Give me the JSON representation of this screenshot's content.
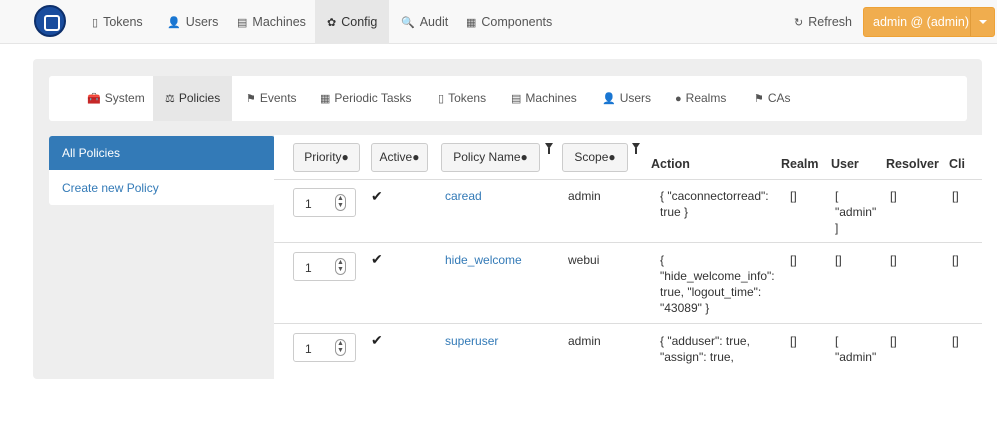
{
  "topnav": {
    "items": [
      {
        "label": "Tokens",
        "icon": "▯"
      },
      {
        "label": "Users",
        "icon": "👤"
      },
      {
        "label": "Machines",
        "icon": "▤"
      },
      {
        "label": "Config",
        "icon": "✿"
      },
      {
        "label": "Audit",
        "icon": "🔍"
      },
      {
        "label": "Components",
        "icon": "▦"
      }
    ],
    "refresh": {
      "label": "Refresh",
      "icon": "↻"
    },
    "admin_label": "admin @ (admin)"
  },
  "subnav": {
    "items": [
      {
        "label": "System",
        "icon": "🧰"
      },
      {
        "label": "Policies",
        "icon": "⚖"
      },
      {
        "label": "Events",
        "icon": "⚑"
      },
      {
        "label": "Periodic Tasks",
        "icon": "▦"
      },
      {
        "label": "Tokens",
        "icon": "▯"
      },
      {
        "label": "Machines",
        "icon": "▤"
      },
      {
        "label": "Users",
        "icon": "👤"
      },
      {
        "label": "Realms",
        "icon": "●"
      },
      {
        "label": "CAs",
        "icon": "⚑"
      }
    ]
  },
  "sidebar": {
    "all_policies": "All Policies",
    "create_policy": "Create new Policy"
  },
  "table": {
    "headers": {
      "priority": "Priority●",
      "active": "Active●",
      "policy_name": "Policy Name●",
      "scope": "Scope●",
      "action": "Action",
      "realm": "Realm",
      "user": "User",
      "resolver": "Resolver",
      "client": "Cli"
    },
    "rows": [
      {
        "priority": "1",
        "active": "✔",
        "name": "caread",
        "scope": "admin",
        "action": [
          "{ \"caconnectorread\":",
          "true }"
        ],
        "realm": "[]",
        "user": [
          "[",
          "\"admin\"",
          "]"
        ],
        "resolver": "[]",
        "client": "[]"
      },
      {
        "priority": "1",
        "active": "✔",
        "name": "hide_welcome",
        "scope": "webui",
        "action": [
          "{",
          "\"hide_welcome_info\":",
          "true, \"logout_time\":",
          "\"43089\" }"
        ],
        "realm": "[]",
        "user": [
          "[]"
        ],
        "resolver": "[]",
        "client": "[]"
      },
      {
        "priority": "1",
        "active": "✔",
        "name": "superuser",
        "scope": "admin",
        "action": [
          "{ \"adduser\": true,",
          "\"assign\": true,"
        ],
        "realm": "[]",
        "user": [
          "[",
          "\"admin\""
        ],
        "resolver": "[]",
        "client": "[]"
      }
    ]
  }
}
